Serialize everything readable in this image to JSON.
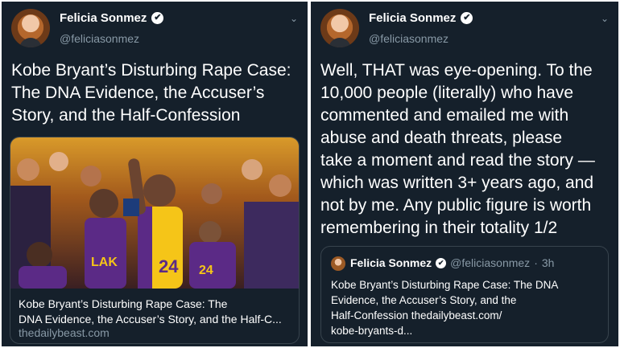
{
  "left_tweet": {
    "author_name": "Felicia Sonmez",
    "author_handle": "@feliciasonmez",
    "text_lines": [
      "Kobe Bryant’s Disturbing Rape Case:",
      "The DNA Evidence, the Accuser’s",
      "Story, and the Half-Confession"
    ],
    "card": {
      "caption_lines": [
        "Kobe Bryant’s Disturbing Rape Case: The",
        "DNA Evidence, the Accuser’s Story, and the Half-C..."
      ],
      "domain": "thedailybeast.com",
      "photo_alt": "basketball-game-photo"
    }
  },
  "right_tweet": {
    "author_name": "Felicia Sonmez",
    "author_handle": "@feliciasonmez",
    "text_lines": [
      "Well, THAT was eye-opening. To the",
      "10,000 people (literally) who have",
      "commented and emailed me with",
      "abuse and death threats, please",
      "take a moment and read the story —",
      "which was written 3+ years ago, and",
      "not by me. Any public figure is worth",
      "remembering in their totality 1/2"
    ],
    "quote": {
      "author_name": "Felicia Sonmez",
      "author_handle": "@feliciasonmez",
      "separator": "·",
      "time": "3h",
      "text_lines": [
        "Kobe Bryant’s Disturbing Rape Case: The DNA",
        "Evidence, the Accuser’s Story, and the",
        "Half-Confession thedailybeast.com/",
        "kobe-bryants-d..."
      ]
    }
  },
  "icons": {
    "verified": "✔",
    "chevron": "⌄"
  },
  "colors": {
    "background": "#15202b",
    "secondary_text": "#8899a6",
    "border": "#38444d",
    "jersey_purple": "#5b2a86",
    "jersey_gold": "#f5c518"
  }
}
